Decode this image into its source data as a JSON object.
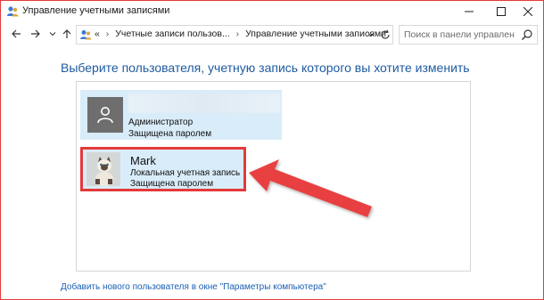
{
  "window": {
    "title": "Управление учетными записями"
  },
  "navigation": {
    "breadcrumb": [
      "Учетные записи пользов...",
      "Управление учетными записями"
    ],
    "search_placeholder": "Поиск в панели управления"
  },
  "main": {
    "heading": "Выберите пользователя, учетную запись которого вы хотите изменить",
    "users": [
      {
        "name": "",
        "role": "Администратор",
        "status": "Защищена паролем"
      },
      {
        "name": "Mark",
        "role": "Локальная учетная запись",
        "status": "Защищена паролем"
      }
    ],
    "add_user_link": "Добавить нового пользователя в окне \"Параметры компьютера\""
  },
  "colors": {
    "heading": "#1e5aa0",
    "tile_background": "#d9ecf9",
    "highlight": "#e43a3a",
    "link": "#1a5fb4"
  }
}
